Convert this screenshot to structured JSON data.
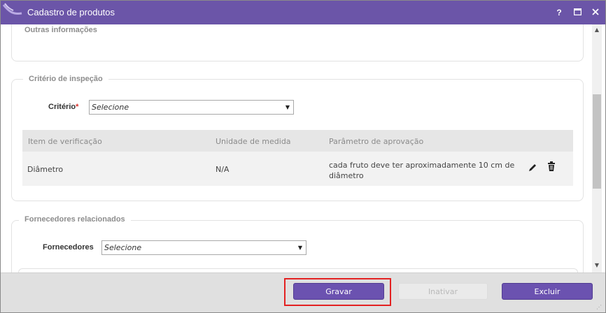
{
  "window": {
    "title": "Cadastro de produtos",
    "help_label": "?",
    "maximize_label": "□",
    "close_label": "✕"
  },
  "sections": {
    "outras": {
      "title": "Outras informações"
    },
    "criterio": {
      "title": "Critério de inspeção",
      "field_label": "Critério",
      "required_mark": "*",
      "select_value": "Selecione",
      "table": {
        "headers": [
          "Item de verificação",
          "Unidade de medida",
          "Parâmetro de aprovação"
        ],
        "rows": [
          {
            "item": "Diâmetro",
            "unidade": "N/A",
            "parametro_line1": "cada fruto deve ter aproximadamente 10 cm de",
            "parametro_line2": "diâmetro"
          }
        ]
      }
    },
    "fornecedores": {
      "title": "Fornecedores relacionados",
      "field_label": "Fornecedores",
      "select_value": "Selecione"
    }
  },
  "footer": {
    "save_label": "Gravar",
    "inactivate_label": "Inativar",
    "delete_label": "Excluir"
  },
  "colors": {
    "titlebar": "#6b55a8",
    "primary_button": "#6b52b0",
    "highlight": "#e32222"
  }
}
